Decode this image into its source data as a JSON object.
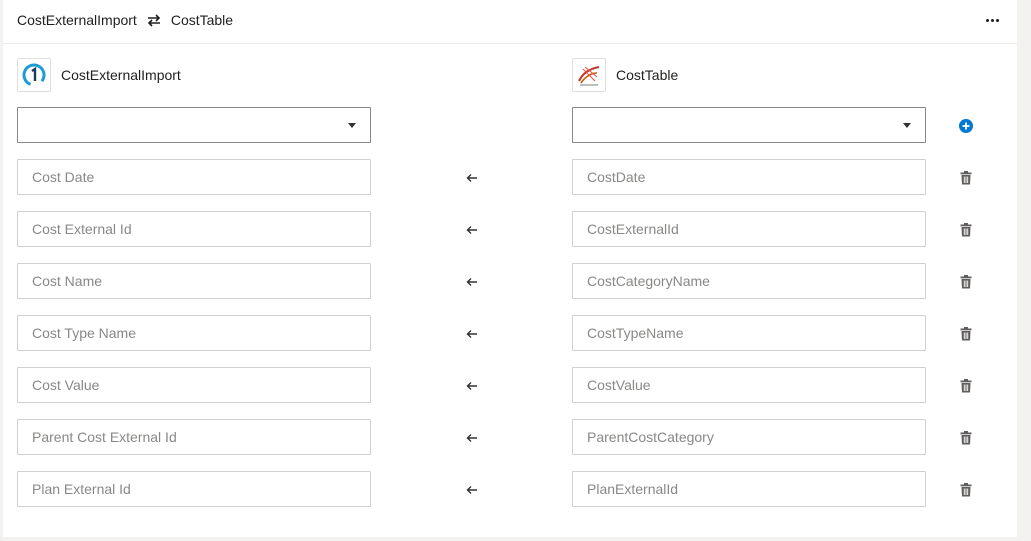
{
  "header": {
    "source": "CostExternalImport",
    "target": "CostTable",
    "swap_icon": "swap-arrows-icon",
    "more_icon": "more-horizontal-icon"
  },
  "source_system": {
    "name": "CostExternalImport",
    "icon": "onestream-logo-icon",
    "select_value": ""
  },
  "target_system": {
    "name": "CostTable",
    "icon": "sql-server-logo-icon",
    "select_value": ""
  },
  "mappings": [
    {
      "source": "Cost Date",
      "target": "CostDate"
    },
    {
      "source": "Cost External Id",
      "target": "CostExternalId"
    },
    {
      "source": "Cost Name",
      "target": "CostCategoryName"
    },
    {
      "source": "Cost Type Name",
      "target": "CostTypeName"
    },
    {
      "source": "Cost Value",
      "target": "CostValue"
    },
    {
      "source": "Parent Cost External Id",
      "target": "ParentCostCategory"
    },
    {
      "source": "Plan External Id",
      "target": "PlanExternalId"
    }
  ],
  "icons": {
    "add": "add-circle-icon",
    "delete": "trash-icon",
    "direction": "arrow-left-icon"
  },
  "colors": {
    "accent": "#0078d4",
    "icon_gray": "#605e5c",
    "placeholder_text": "#8a8886",
    "border": "#d2d0ce"
  }
}
